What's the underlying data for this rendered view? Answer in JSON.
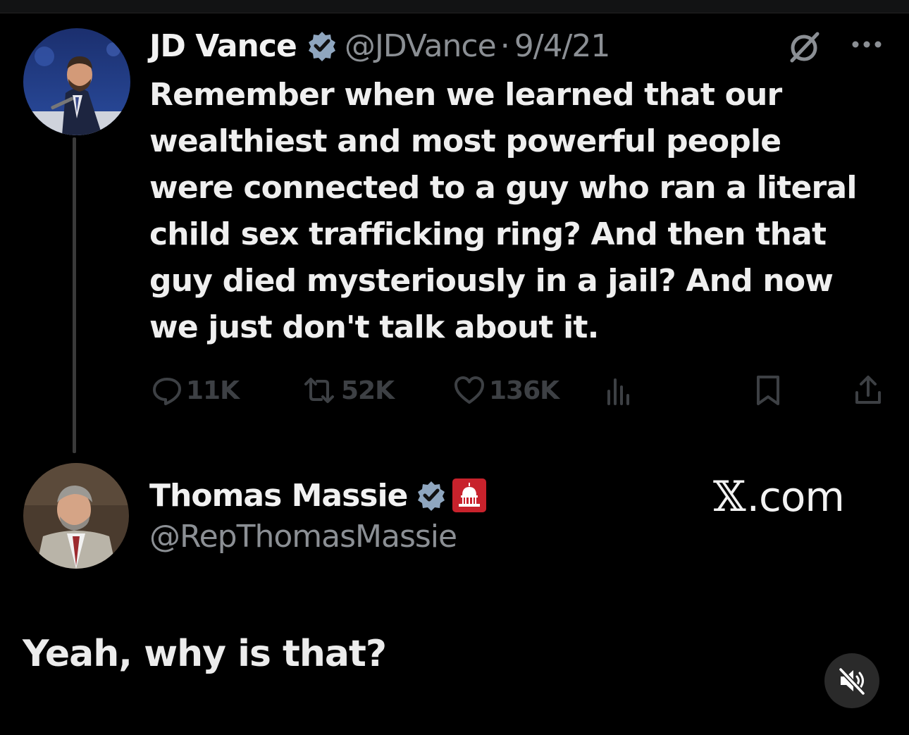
{
  "original_post": {
    "author_name": "JD Vance",
    "handle": "@JDVance",
    "separator": "·",
    "date": "9/4/21",
    "text": "Remember when we learned that our\nwealthiest and most powerful people\nwere connected to a guy who ran a literal\nchild sex trafficking ring? And then that\nguy died mysteriously in a jail? And now\nwe just don't talk about it.",
    "metrics": {
      "replies": "11K",
      "reposts": "52K",
      "likes": "136K"
    }
  },
  "reply_post": {
    "author_name": "Thomas Massie",
    "handle": "@RepThomasMassie"
  },
  "watermark": {
    "x_symbol": "𝕏",
    "domain": ".com"
  },
  "caption": "Yeah, why is that?",
  "icons": {
    "verified": "verified-badge-icon",
    "grok": "grok-icon",
    "more": "more-icon",
    "reply": "reply-icon",
    "repost": "repost-icon",
    "like": "heart-icon",
    "views": "views-icon",
    "bookmark": "bookmark-icon",
    "share": "share-icon",
    "government": "capitol-badge-icon",
    "mute": "muted-speaker-icon"
  },
  "colors": {
    "background": "#000000",
    "text_primary": "#efefef",
    "text_secondary": "#8b8f94",
    "action_icons": "#3d4044",
    "verified_badge": "#8fa6bf",
    "gov_badge": "#c8222c"
  }
}
